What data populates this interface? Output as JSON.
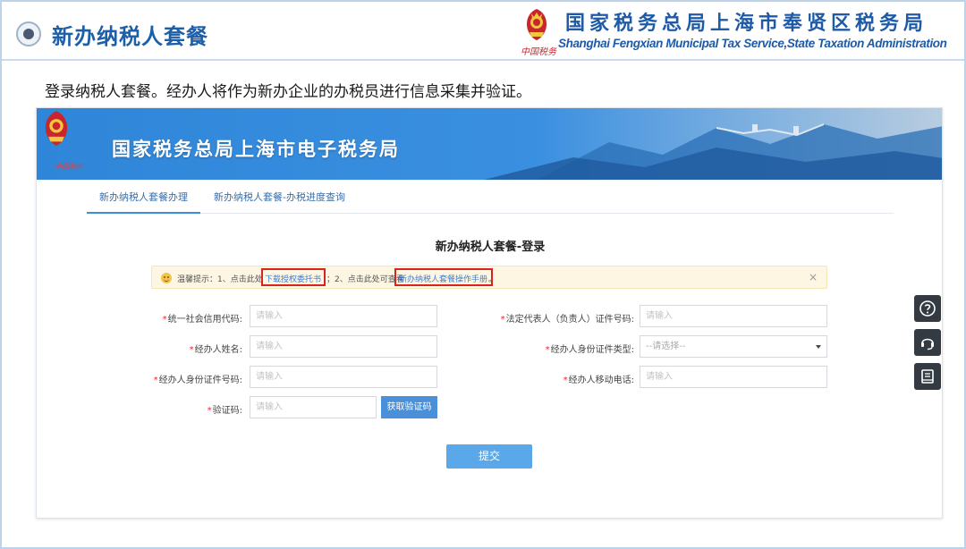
{
  "slide": {
    "title": "新办纳税人套餐",
    "org_cn": "国家税务总局上海市奉贤区税务局",
    "org_en": "Shanghai Fengxian Municipal Tax Service,State Taxation Administration",
    "brand_red": "中国税务",
    "intro": "登录纳税人套餐。经办人将作为新办企业的办税员进行信息采集并验证。"
  },
  "portal": {
    "title": "国家税务总局上海市电子税务局",
    "brand_red": "中国税务",
    "tabs": [
      {
        "label": "新办纳税人套餐办理",
        "active": true
      },
      {
        "label": "新办纳税人套餐-办税进度查询",
        "active": false
      }
    ],
    "form_title": "新办纳税人套餐-登录",
    "notice": {
      "prefix": "温馨提示：1、点击此处",
      "link1": "下载授权委托书",
      "middle": "；2、点击此处可查看",
      "link2": "新办纳税人套餐操作手册",
      "suffix": "。",
      "close": "×"
    },
    "fields": {
      "credit_code": {
        "label": "统一社会信用代码:",
        "placeholder": "请输入"
      },
      "agent_name": {
        "label": "经办人姓名:",
        "placeholder": "请输入"
      },
      "agent_id_no": {
        "label": "经办人身份证件号码:",
        "placeholder": "请输入"
      },
      "verify_code": {
        "label": "验证码:",
        "placeholder": "请输入"
      },
      "legal_rep_id": {
        "label": "法定代表人（负责人）证件号码:",
        "placeholder": "请输入"
      },
      "agent_id_type": {
        "label": "经办人身份证件类型:",
        "value": "--请选择--"
      },
      "agent_mobile": {
        "label": "经办人移动电话:",
        "placeholder": "请输入"
      }
    },
    "required_mark": "*",
    "get_code_button": "获取验证码",
    "submit_button": "提交"
  },
  "side_tools": [
    "help-icon",
    "headset-icon",
    "manual-icon"
  ],
  "colors": {
    "title_blue": "#1d5fa8",
    "banner_blue": "#3b8ee0",
    "button_blue": "#4a90d9",
    "highlight_red": "#d9231f",
    "required_red": "#ee2233"
  }
}
